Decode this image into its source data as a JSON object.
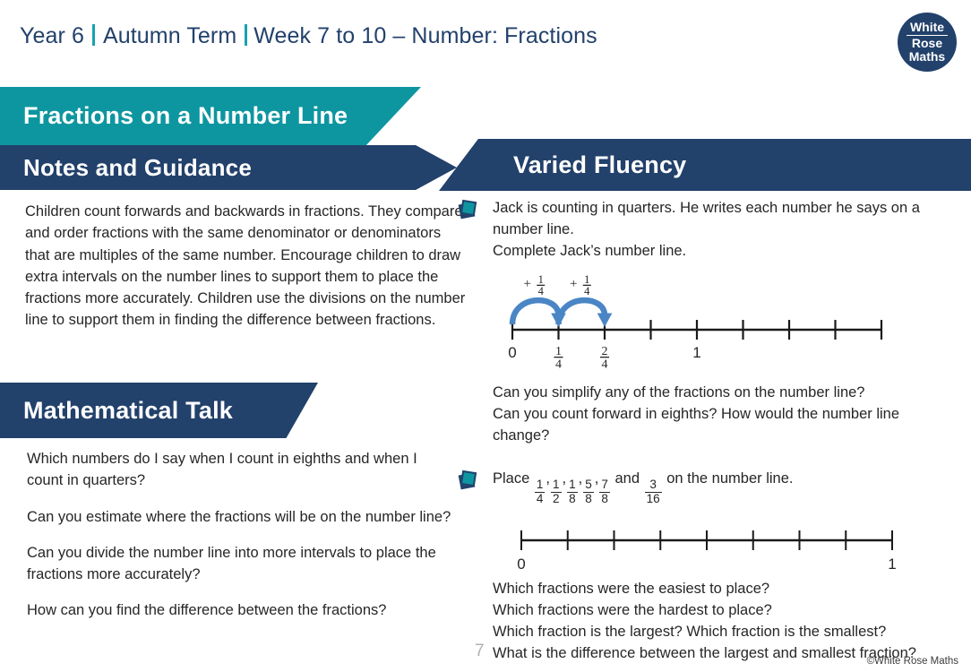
{
  "header": {
    "year": "Year 6",
    "term": "Autumn Term",
    "week": "Week 7 to 10 – Number: Fractions"
  },
  "logo": {
    "line1": "White",
    "line2": "Rose",
    "line3": "Maths"
  },
  "banners": {
    "topic": "Fractions on a Number Line",
    "notes": "Notes and Guidance",
    "talk": "Mathematical Talk",
    "varied_fluency": "Varied Fluency"
  },
  "notes": {
    "body": "Children count forwards and backwards in fractions. They compare and order fractions with the same denominator or denominators that are multiples of the same number. Encourage children to draw extra intervals on the number lines to support them to place the fractions more accurately. Children use the divisions on the number line to support them in finding the difference between fractions."
  },
  "mathematical_talk": {
    "questions": [
      "Which numbers do I say when I count in eighths and when I count in quarters?",
      "Can you estimate where the fractions will be on the number line?",
      "Can you divide the number line into more intervals to place the fractions more accurately?",
      "How can you find the difference between the fractions?"
    ]
  },
  "varied_fluency": {
    "q1": {
      "line1": "Jack is counting in quarters. He writes each number he says on a",
      "line2": "number line.",
      "line3": "Complete Jack’s number line."
    },
    "q1_followups": [
      "Can you simplify any of the fractions on the number line?",
      "Can you count forward in eighths? How would the number line",
      "change?"
    ],
    "q2": {
      "lead": "Place",
      "fractions": [
        {
          "num": "1",
          "den": "4"
        },
        {
          "num": "1",
          "den": "2"
        },
        {
          "num": "1",
          "den": "8"
        },
        {
          "num": "5",
          "den": "8"
        },
        {
          "num": "7",
          "den": "8"
        }
      ],
      "conjunction": "and",
      "last_fraction": {
        "num": "3",
        "den": "16"
      },
      "tail": "on the number line."
    },
    "q2_followups": [
      "Which fractions were the easiest to place?",
      "Which fractions were the hardest to place?",
      "Which fraction is the largest? Which fraction is the smallest?",
      "What is the difference between the largest and smallest fraction?"
    ]
  },
  "numberline1": {
    "ticks": 9,
    "labels": [
      {
        "index": 0,
        "type": "whole",
        "text": "0"
      },
      {
        "index": 1,
        "type": "fraction",
        "num": "1",
        "den": "4"
      },
      {
        "index": 2,
        "type": "fraction",
        "num": "2",
        "den": "4"
      },
      {
        "index": 4,
        "type": "whole",
        "text": "1"
      }
    ],
    "jumps": [
      {
        "from": 0,
        "to": 1,
        "label_num": "1",
        "label_den": "4",
        "sign": "+"
      },
      {
        "from": 1,
        "to": 2,
        "label_num": "1",
        "label_den": "4",
        "sign": "+"
      }
    ],
    "arrow_color": "#4a86c5"
  },
  "numberline2": {
    "ticks": 9,
    "labels": [
      {
        "index": 0,
        "type": "whole",
        "text": "0"
      },
      {
        "index": 8,
        "type": "whole",
        "text": "1"
      }
    ]
  },
  "footer": {
    "page_number": "7",
    "copyright": "©White Rose Maths"
  },
  "colors": {
    "teal": "#0d96a0",
    "navy": "#22416b",
    "arrow_blue": "#4a86c5",
    "text": "#262626"
  }
}
